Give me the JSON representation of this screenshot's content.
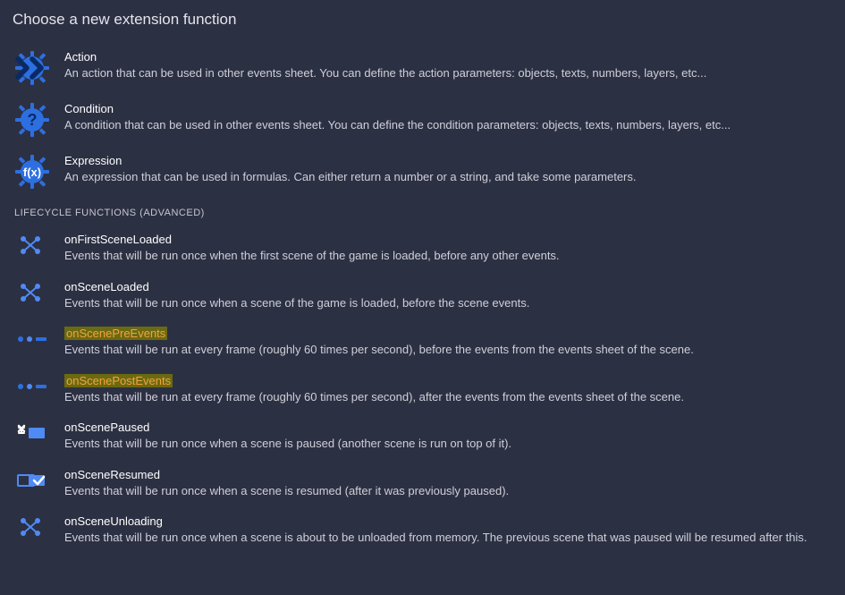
{
  "title": "Choose a new extension function",
  "topItems": [
    {
      "icon": "gear-chevrons",
      "title": "Action",
      "desc": "An action that can be used in other events sheet. You can define the action parameters: objects, texts, numbers, layers, etc..."
    },
    {
      "icon": "gear-question",
      "title": "Condition",
      "desc": "A condition that can be used in other events sheet. You can define the condition parameters: objects, texts, numbers, layers, etc..."
    },
    {
      "icon": "gear-fx",
      "title": "Expression",
      "desc": "An expression that can be used in formulas. Can either return a number or a string, and take some parameters."
    }
  ],
  "lifecycleLabel": "LIFECYCLE FUNCTIONS (ADVANCED)",
  "lifecycleItems": [
    {
      "icon": "cross-dots",
      "title": "onFirstSceneLoaded",
      "highlight": false,
      "desc": "Events that will be run once when the first scene of the game is loaded, before any other events."
    },
    {
      "icon": "cross-dots",
      "title": "onSceneLoaded",
      "highlight": false,
      "desc": "Events that will be run once when a scene of the game is loaded, before the scene events."
    },
    {
      "icon": "dots-line",
      "title": "onScenePreEvents",
      "highlight": true,
      "desc": "Events that will be run at every frame (roughly 60 times per second), before the events from the events sheet of the scene."
    },
    {
      "icon": "dots-line",
      "title": "onScenePostEvents",
      "highlight": true,
      "desc": "Events that will be run at every frame (roughly 60 times per second), after the events from the events sheet of the scene."
    },
    {
      "icon": "pause-rect",
      "title": "onScenePaused",
      "highlight": false,
      "desc": "Events that will be run once when a scene is paused (another scene is run on top of it)."
    },
    {
      "icon": "resume-rect",
      "title": "onSceneResumed",
      "highlight": false,
      "desc": "Events that will be run once when a scene is resumed (after it was previously paused)."
    },
    {
      "icon": "cross-dots",
      "title": "onSceneUnloading",
      "highlight": false,
      "desc": "Events that will be run once when a scene is about to be unloaded from memory. The previous scene that was paused will be resumed after this."
    }
  ]
}
